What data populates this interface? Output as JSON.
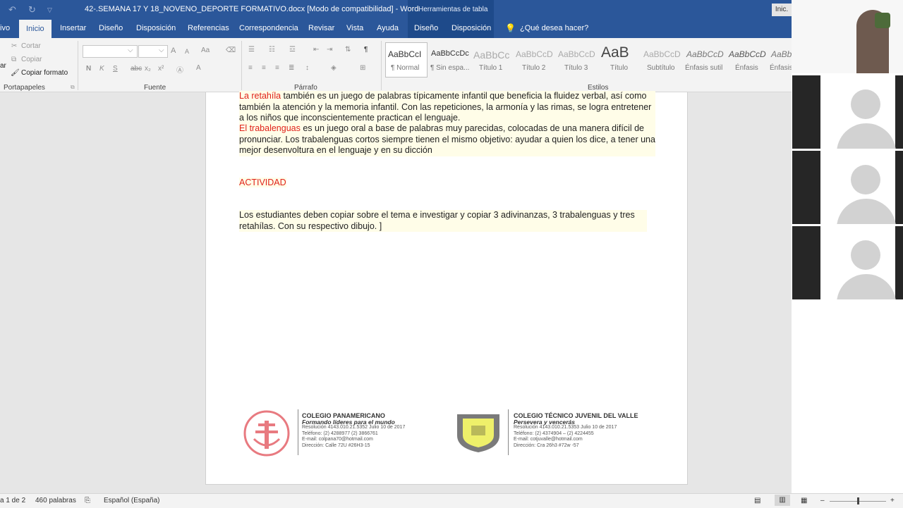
{
  "titlebar": {
    "doc_title": "42-.SEMANA 17 Y 18_NOVENO_DEPORTE FORMATIVO.docx  [Modo de compatibilidad]  -  Word",
    "context_title": "Herramientas de tabla",
    "signin": "Inic."
  },
  "tabs": {
    "archivo": "ivo",
    "inicio": "Inicio",
    "insertar": "Insertar",
    "diseno": "Diseño",
    "disposicion": "Disposición",
    "referencias": "Referencias",
    "correspondencia": "Correspondencia",
    "revisar": "Revisar",
    "vista": "Vista",
    "ayuda": "Ayuda",
    "ctx_diseno": "Diseño",
    "ctx_disposicion": "Disposición",
    "tell_me": "¿Qué desea hacer?"
  },
  "ribbon": {
    "clipboard": {
      "cortar": "Cortar",
      "copiar": "Copiar",
      "copiar_formato": "Copiar formato",
      "pegar_fragment": "ar",
      "label": "Portapapeles"
    },
    "font": {
      "label": "Fuente",
      "bold": "N",
      "italic": "K",
      "underline": "S",
      "strike": "abc",
      "sub": "x₂",
      "sup": "x²",
      "grow": "A",
      "shrink": "A",
      "case": "Aa"
    },
    "paragraph": {
      "label": "Párrafo",
      "pilcrow": "¶"
    },
    "styles": {
      "label": "Estilos",
      "items": [
        {
          "preview": "AaBbCcI",
          "name": "¶ Normal"
        },
        {
          "preview": "AaBbCcDc",
          "name": "¶ Sin espa..."
        },
        {
          "preview": "AaBbCc",
          "name": "Título 1"
        },
        {
          "preview": "AaBbCcD",
          "name": "Título 2"
        },
        {
          "preview": "AaBbCcD",
          "name": "Título 3"
        },
        {
          "preview": "AaB",
          "name": "Título"
        },
        {
          "preview": "AaBbCcD",
          "name": "Subtítulo"
        },
        {
          "preview": "AaBbCcD",
          "name": "Énfasis sutil"
        },
        {
          "preview": "AaBbCcD",
          "name": "Énfasis"
        },
        {
          "preview": "AaBb",
          "name": "Énfasis"
        }
      ]
    }
  },
  "document": {
    "p1_red": "La retahíla",
    "p1_rest": " también es un juego de palabras típicamente infantil que beneficia la fluidez verbal, así como también la atención y la memoria infantil. Con las repeticiones, la armonía y las rimas, se logra entretener a los niños que inconscientemente practican el lenguaje.",
    "p2_red": "El trabalenguas",
    "p2_rest": " es un juego oral a base de palabras muy parecidas, colocadas de una manera difícil de pronunciar. Los trabalenguas cortos siempre tienen el mismo objetivo: ayudar a quien los dice, a tener una mejor desenvoltura en el lenguaje y en su dicción",
    "heading": "ACTIVIDAD",
    "activity": "Los estudiantes deben copiar sobre el tema e investigar y copiar 3 adivinanzas, 3 trabalenguas y tres retahílas. Con su respectivo dibujo. "
  },
  "footer": {
    "left": {
      "title": "COLEGIO PANAMERICANO",
      "motto": "Formando líderes para el mundo",
      "line1": "Resolución 4143.010.21.5352 Julio 10 de 2017",
      "line2": "Teléfono: (2) 4288977 (2) 3866761",
      "line3": "E-mail: colpana70@hotmail.com",
      "line4": "Dirección: Calle 72U #26H3-15",
      "seal_text": "COLEGIO PANAMERICANO"
    },
    "right": {
      "title": "COLEGIO TÉCNICO JUVENIL DEL VALLE",
      "motto": "Persevera y vencerás",
      "line1": "Resolución 4143.010.21.5353 Julio 10 de 2017",
      "line2": "Teléfono: (2) 4374904 – (2) 4224455",
      "line3": "E-mail: cotjuvalle@hotmail.com",
      "line4": "Dirección: Cra 26h3 #72w -57"
    }
  },
  "statusbar": {
    "page": "a 1 de 2",
    "words": "460 palabras",
    "language": "Español (España)"
  },
  "colors": {
    "word_blue": "#2b579a",
    "accent_red": "#e0221a"
  }
}
